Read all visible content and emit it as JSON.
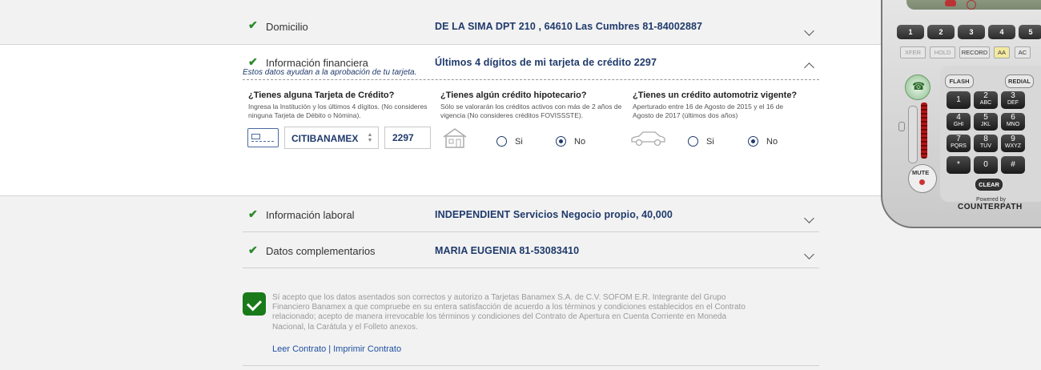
{
  "rows": {
    "domicilio": {
      "label": "Domicilio",
      "value": "DE LA SIMA DPT 210 , 64610 Las Cumbres 81-84002887"
    },
    "financiera": {
      "label": "Información financiera",
      "value": "Últimos 4 dígitos de mi tarjeta de crédito 2297",
      "hint": "Estos datos ayudan a la aprobación de tu tarjeta."
    },
    "laboral": {
      "label": "Información laboral",
      "value": "INDEPENDIENT Servicios Negocio propio, 40,000"
    },
    "complementarios": {
      "label": "Datos complementarios",
      "value": "MARIA EUGENIA 81-53083410"
    }
  },
  "questions": {
    "tarjeta": {
      "title": "¿Tienes alguna Tarjeta de Crédito?",
      "sub": "Ingresa la Institución y los últimos 4 dígitos. (No consideres ninguna Tarjeta de Débito o Nómina).",
      "bank": "CITIBANAMEX",
      "digits": "2297"
    },
    "hipotecario": {
      "title": "¿Tienes algún crédito hipotecario?",
      "sub": "Sólo se valorarán los créditos activos con más de 2 años de vigencia (No consideres créditos FOVISSSTE).",
      "yes": "Si",
      "no": "No",
      "selected": "No"
    },
    "automotriz": {
      "title": "¿Tienes un crédito automotriz vigente?",
      "sub": "Aperturado entre 16 de Agosto de 2015 y el 16 de Agosto de 2017 (últimos dos años)",
      "yes": "Si",
      "no": "No",
      "selected": "No"
    }
  },
  "agreement": {
    "text": "Sí acepto que los datos asentados son correctos y autorizo a Tarjetas Banamex S.A. de C.V. SOFOM E.R. Integrante del Grupo Financiero Banamex a que compruebe en su entera satisfacción de acuerdo a los términos y condiciones establecidos en el Contrato relacionado; acepto de manera irrevocable los términos y condiciones del Contrato de Apertura en Cuenta Corriente en Moneda Nacional, la Carátula y el Folleto anexos.",
    "read_link": "Leer Contrato",
    "print_link": "Imprimir Contrato",
    "separator": "|",
    "checked": true
  },
  "phone": {
    "line_buttons": [
      "1",
      "2",
      "3",
      "4",
      "5"
    ],
    "function_buttons": [
      "XFER",
      "HOLD",
      "RECORD",
      "AA",
      "AC"
    ],
    "flash": "FLASH",
    "redial": "REDIAL",
    "mute": "MUTE",
    "clear": "CLEAR",
    "keys": [
      {
        "d": "1",
        "l": ""
      },
      {
        "d": "2",
        "l": "ABC"
      },
      {
        "d": "3",
        "l": "DEF"
      },
      {
        "d": "4",
        "l": "GHI"
      },
      {
        "d": "5",
        "l": "JKL"
      },
      {
        "d": "6",
        "l": "MNO"
      },
      {
        "d": "7",
        "l": "PQRS"
      },
      {
        "d": "8",
        "l": "TUV"
      },
      {
        "d": "9",
        "l": "WXYZ"
      },
      {
        "d": "*",
        "l": ""
      },
      {
        "d": "0",
        "l": ""
      },
      {
        "d": "#",
        "l": ""
      }
    ],
    "powered_by": "Powered by",
    "brand": "COUNTERPATH"
  }
}
